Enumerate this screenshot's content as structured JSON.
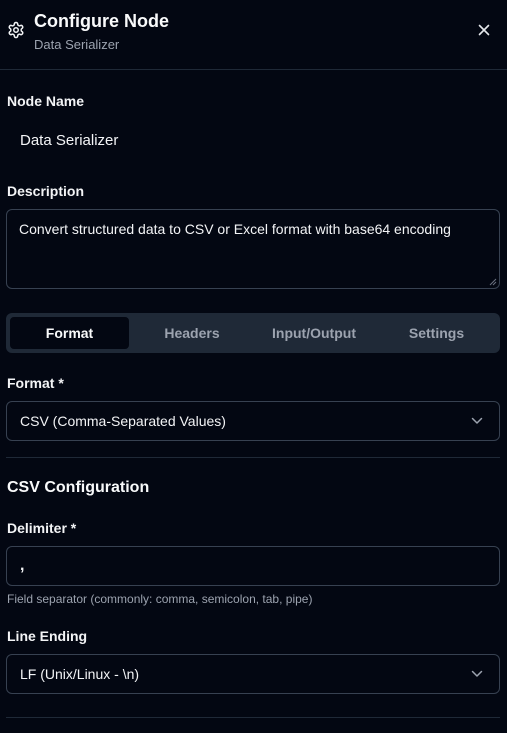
{
  "header": {
    "title": "Configure Node",
    "subtitle": "Data Serializer",
    "icon": "gear-icon",
    "close_icon": "close-icon"
  },
  "node_name": {
    "label": "Node Name",
    "value": "Data Serializer"
  },
  "description": {
    "label": "Description",
    "value": "Convert structured data to CSV or Excel format with base64 encoding"
  },
  "tabs": [
    {
      "label": "Format",
      "active": true
    },
    {
      "label": "Headers",
      "active": false
    },
    {
      "label": "Input/Output",
      "active": false
    },
    {
      "label": "Settings",
      "active": false
    }
  ],
  "format": {
    "label": "Format *",
    "selected": "CSV (Comma-Separated Values)"
  },
  "csv_config": {
    "title": "CSV Configuration",
    "delimiter": {
      "label": "Delimiter *",
      "value": ",",
      "hint": "Field separator (commonly: comma, semicolon, tab, pipe)"
    },
    "line_ending": {
      "label": "Line Ending",
      "selected": "LF (Unix/Linux - \\n)"
    }
  },
  "colors": {
    "background": "#030712",
    "border": "#374151",
    "tab_bar": "#1f2937",
    "muted_text": "#9ca3af"
  }
}
